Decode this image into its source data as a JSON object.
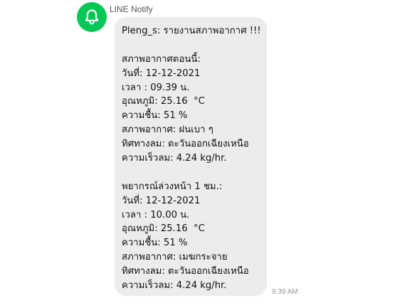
{
  "sender": {
    "name": "LINE Notify",
    "avatar_icon": "bell-icon",
    "avatar_color": "#06c755"
  },
  "message": {
    "lines": [
      "Pleng_s: รายงานสภาพอากาศ !!!",
      "",
      "สภาพอากาศตอนนี้:",
      "วันที่: 12-12-2021",
      "เวลา : 09.39 น.",
      "อุณหภูมิ: 25.16  °C",
      "ความชื้น: 51 %",
      "สภาพอากาศ: ฝนเบา ๆ",
      "ทิศทางลม: ตะวันออกเฉียงเหนือ",
      "ความเร็วลม: 4.24 kg/hr.",
      "",
      "พยากรณ์ล่วงหน้า 1 ชม.:",
      "วันที่: 12-12-2021",
      "เวลา : 10.00 น.",
      "อุณหภูมิ: 25.16  °C",
      "ความชื้น: 51 %",
      "สภาพอากาศ: เมฆกระจาย",
      "ทิศทางลม: ตะวันออกเฉียงเหนือ",
      "ความเร็วลม: 4.24 kg/hr."
    ],
    "time": "9:39 AM"
  }
}
